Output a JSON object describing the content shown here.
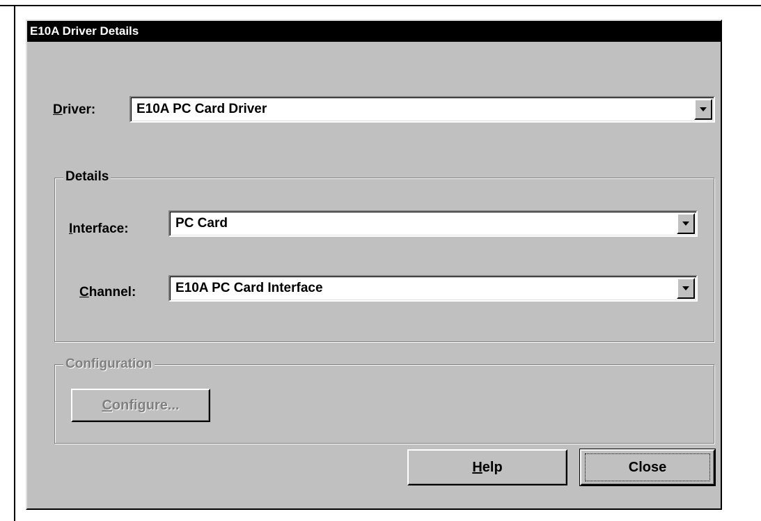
{
  "window": {
    "title": "E10A Driver Details"
  },
  "driver": {
    "label_accel": "D",
    "label_rest": "river:",
    "value": "E10A PC Card Driver",
    "arrow_icon": "dropdown-arrow-icon"
  },
  "details": {
    "group_label": "Details",
    "interface": {
      "label_accel": "I",
      "label_rest": "nterface:",
      "value": "PC Card"
    },
    "channel": {
      "label_accel": "C",
      "label_rest": "hannel:",
      "value": "E10A PC Card Interface"
    }
  },
  "configuration": {
    "group_label": "Configuration",
    "configure_accel": "C",
    "configure_rest": "onfigure...",
    "enabled": false
  },
  "buttons": {
    "help_accel": "H",
    "help_rest": "elp",
    "close_label": "Close"
  },
  "colors": {
    "dialog_face": "#c0c0c0",
    "titlebar": "#000000",
    "disabled_text": "#808080"
  }
}
